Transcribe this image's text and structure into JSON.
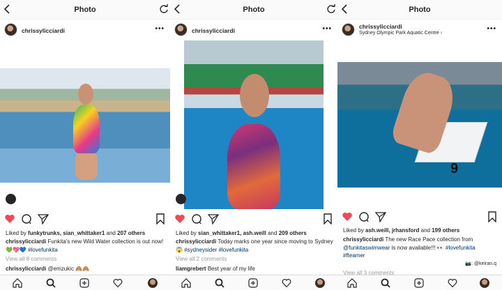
{
  "colors": {
    "like_red": "#ed4956",
    "text": "#262626",
    "hashtag": "#003569",
    "muted": "#999999"
  },
  "posts": [
    {
      "title": "Photo",
      "username": "chrissylicciardi",
      "location": "",
      "liked_by_prefix": "Liked by",
      "liked_users": "funkytrunks, sian_whittaker1",
      "liked_and": "and",
      "liked_count": "207 others",
      "caption_user": "chrissylicciardi",
      "caption_text": "Funkita's new Wild Water collection is out now! 💚💖💙",
      "caption_tag": "#lovefunkita",
      "caption_tag_pre": "",
      "caption_extra": "",
      "caption_tag2": "",
      "view_all": "View all 8 comments",
      "comment_user": "chrissylicciardi",
      "comment_text": "@emzukic 🙈🙈",
      "credit": ""
    },
    {
      "title": "Photo",
      "username": "chrissylicciardi",
      "location": "",
      "liked_by_prefix": "Liked by",
      "liked_users": "sian_whittaker1, ash.weill",
      "liked_and": "and",
      "liked_count": "209 others",
      "caption_user": "chrissylicciardi",
      "caption_text": "Today marks one year since moving to Sydney 😱",
      "caption_tag": "#sydneysider #lovefunkita",
      "caption_tag_pre": "",
      "caption_extra": "",
      "caption_tag2": "",
      "view_all": "View all 2 comments",
      "comment_user": "liamgrebert",
      "comment_text": "Best year of my life",
      "credit": ""
    },
    {
      "title": "Photo",
      "username": "chrissylicciardi",
      "location": "Sydney Olympic Park Aquatic Centre",
      "liked_by_prefix": "Liked by",
      "liked_users": "ash.weill, jrhansford",
      "liked_and": "and",
      "liked_count": "199 others",
      "caption_user": "chrissylicciardi",
      "caption_text": "The new Race Pace collection from",
      "caption_tag_pre": "@funkitaswimwear",
      "caption_extra": "is now available!!! 👀",
      "caption_tag": "#lovefunkita",
      "caption_tag2": "#fteamer",
      "view_all": "View all 3 comments",
      "comment_user": "",
      "comment_text": "",
      "credit": "📷: @keiran.q"
    }
  ],
  "icons": {
    "back": "chevron-left-icon",
    "refresh": "refresh-icon",
    "more": "more-dots-icon",
    "like": "heart-filled-icon",
    "comment": "comment-icon",
    "share": "send-icon",
    "save": "bookmark-icon",
    "home": "home-icon",
    "search": "search-icon",
    "add": "add-post-icon",
    "activity": "heart-outline-icon",
    "profile": "profile-avatar"
  },
  "photo_content": {
    "post3_block_number": "9"
  }
}
